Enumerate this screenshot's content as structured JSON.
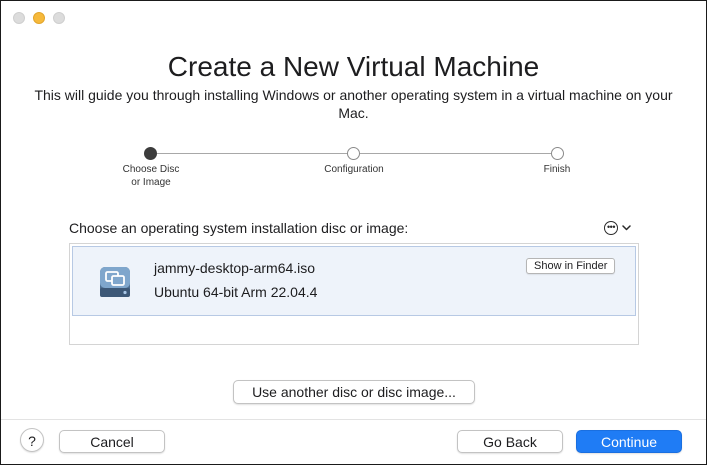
{
  "window": {
    "title": "Create a New Virtual Machine",
    "subtitle": "This will guide you through installing Windows or another operating system in a virtual machine on your Mac."
  },
  "steps": [
    {
      "label": "Choose Disc\nor Image",
      "state": "active"
    },
    {
      "label": "Configuration",
      "state": "pending"
    },
    {
      "label": "Finish",
      "state": "pending"
    }
  ],
  "prompt": "Choose an operating system installation disc or image:",
  "more_icon": "ellipsis-circle-icon",
  "disc_list": {
    "items": [
      {
        "icon": "disc-image-icon",
        "file": "jammy-desktop-arm64.iso",
        "os": "Ubuntu 64-bit Arm 22.04.4",
        "action": "Show in Finder"
      }
    ]
  },
  "buttons": {
    "use_another": "Use another disc or disc image...",
    "help": "?",
    "cancel": "Cancel",
    "go_back": "Go Back",
    "continue": "Continue"
  },
  "colors": {
    "accent": "#1f7cf5",
    "selection": "#eef3fa",
    "minimize": "#f6b93b"
  }
}
